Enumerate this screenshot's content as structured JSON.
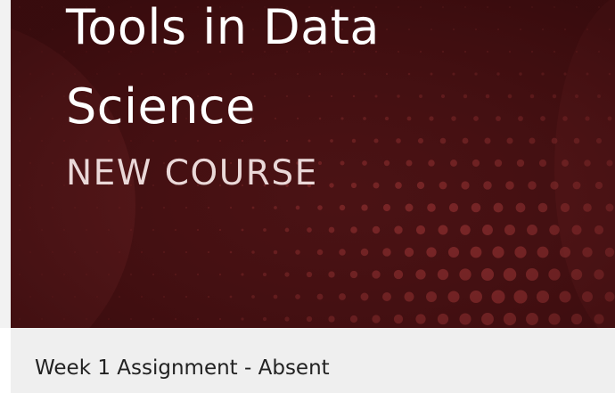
{
  "banner": {
    "title": "Tools in Data Science",
    "subtitle": "NEW COURSE",
    "background_color": "#4a1214",
    "dot_color": "#a83a3a"
  },
  "card": {
    "assignment_title": "Week 1 Assignment - Absent"
  }
}
